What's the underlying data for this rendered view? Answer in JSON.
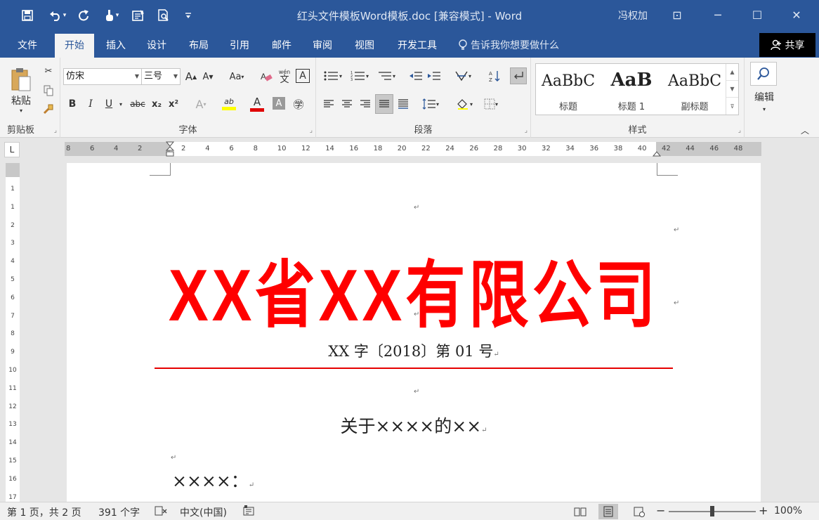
{
  "window": {
    "title": "红头文件模板Word模板.doc [兼容模式] - Word",
    "user": "冯权加",
    "controls": {
      "ribbon_display": "⊡",
      "minimize": "─",
      "maximize": "☐",
      "close": "✕"
    }
  },
  "quick_access": {
    "save_icon": "save-icon",
    "undo_icon": "undo-icon",
    "redo_icon": "redo-icon",
    "touch_icon": "touch-mode-icon",
    "form_icon": "form-icon",
    "preview_icon": "print-preview-icon",
    "customize_icon": "customize-icon"
  },
  "tabs": [
    {
      "label": "文件",
      "active": false
    },
    {
      "label": "开始",
      "active": true
    },
    {
      "label": "插入",
      "active": false
    },
    {
      "label": "设计",
      "active": false
    },
    {
      "label": "布局",
      "active": false
    },
    {
      "label": "引用",
      "active": false
    },
    {
      "label": "邮件",
      "active": false
    },
    {
      "label": "审阅",
      "active": false
    },
    {
      "label": "视图",
      "active": false
    },
    {
      "label": "开发工具",
      "active": false
    }
  ],
  "tell_me": "告诉我你想要做什么",
  "share": "共享",
  "ribbon": {
    "clipboard": {
      "label": "剪贴板",
      "paste": "粘贴"
    },
    "font": {
      "label": "字体",
      "font_name": "仿宋",
      "font_size": "三号",
      "change_case": "Aa",
      "phonetic_top": "wén",
      "phonetic_bottom": "文",
      "char_border": "A",
      "bold": "B",
      "italic": "I",
      "underline": "U",
      "strike": "abc",
      "subscript": "x₂",
      "superscript": "x²",
      "grow": "A",
      "shrink": "A",
      "text_effect": "A",
      "highlight": "ab",
      "font_color": "A",
      "char_shading": "A",
      "enclose": "㊫"
    },
    "paragraph": {
      "label": "段落"
    },
    "styles": {
      "label": "样式",
      "items": [
        {
          "sample": "AaBbC",
          "name": "标题"
        },
        {
          "sample": "AaB",
          "name": "标题 1"
        },
        {
          "sample": "AaBbC",
          "name": "副标题"
        }
      ]
    },
    "editing": {
      "label": "编辑"
    }
  },
  "ruler": {
    "corner": "L",
    "left_ticks": [
      "8",
      "6",
      "4",
      "2"
    ],
    "ticks": [
      "2",
      "4",
      "6",
      "8",
      "10",
      "12",
      "14",
      "16",
      "18",
      "20",
      "22",
      "24",
      "26",
      "28",
      "30",
      "32",
      "34",
      "36",
      "38",
      "40",
      "42",
      "44",
      "46",
      "48"
    ],
    "vertical_ticks": [
      "1",
      "1",
      "2",
      "3",
      "4",
      "5",
      "6",
      "7",
      "8",
      "9",
      "10",
      "11",
      "12",
      "13",
      "14",
      "15",
      "16",
      "17"
    ]
  },
  "document": {
    "red_head": "XX省XX有限公司",
    "doc_number": "XX 字〔2018〕第 01 号",
    "subject": "关于××××的××",
    "addressee": "××××：",
    "para_mark": "↵"
  },
  "status": {
    "page": "第 1 页，共 2 页",
    "words": "391 个字",
    "language": "中文(中国)",
    "zoom": "100%",
    "zoom_minus": "−",
    "zoom_plus": "+",
    "zoom_level": 1.0
  },
  "colors": {
    "title_bar": "#2b579a",
    "red_head": "#ff0000",
    "red_rule": "#e60000",
    "ribbon_bg": "#f3f3f3"
  }
}
